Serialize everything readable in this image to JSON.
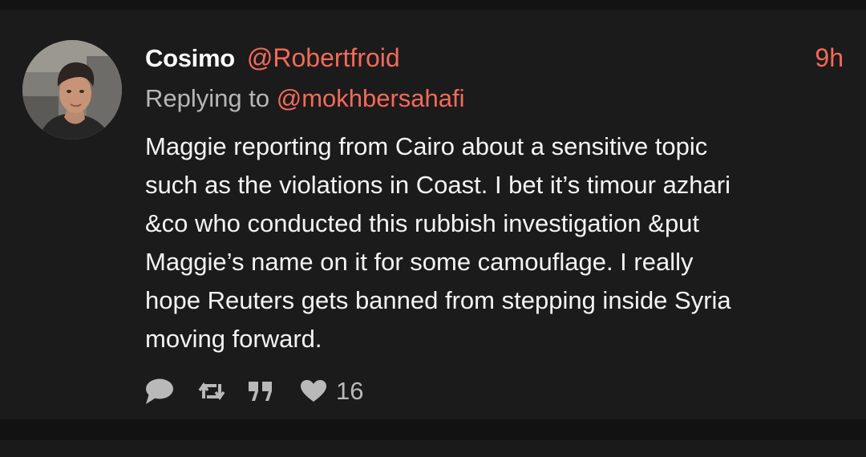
{
  "tweet": {
    "author_name": "Cosimo",
    "author_handle": "@Robertfroid",
    "timestamp": "9h",
    "reply_prefix": "Replying to",
    "reply_to": "@mokhbersahafi",
    "body_lines": [
      "Maggie reporting from Cairo about a sensitive topic",
      "such as the violations in Coast. I bet it’s timour azhari",
      "&co who conducted this rubbish investigation &put",
      "Maggie’s name on it for some camouflage. I really",
      "hope Reuters gets banned from stepping inside Syria",
      "moving forward."
    ],
    "actions": {
      "reply_icon": "reply-bubble-icon",
      "retweet_icon": "retweet-icon",
      "quote_icon": "quote-icon",
      "like_icon": "heart-icon",
      "like_count": "16"
    }
  },
  "colors": {
    "background": "#1c1b1b",
    "separator": "#121212",
    "name": "#ffffff",
    "accent": "#f26a5a",
    "secondary_text": "#b7b7b7",
    "body_text": "#f4f4f4",
    "icon": "#b9b9b9"
  }
}
